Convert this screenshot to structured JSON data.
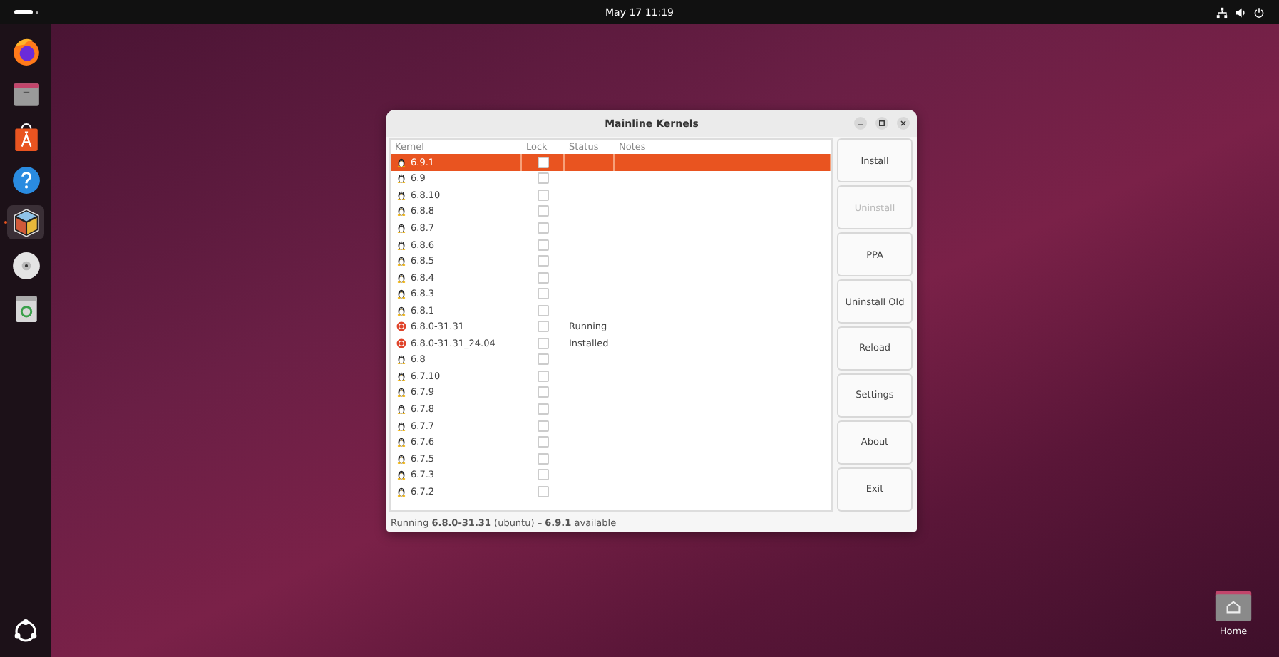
{
  "top_bar": {
    "clock": "May 17  11:19"
  },
  "dock": {
    "items": [
      {
        "kind": "browser",
        "selected": false
      },
      {
        "kind": "files",
        "selected": false
      },
      {
        "kind": "store",
        "selected": false
      },
      {
        "kind": "help",
        "selected": false
      },
      {
        "kind": "cube",
        "selected": true
      },
      {
        "kind": "disc",
        "selected": false
      },
      {
        "kind": "trash",
        "selected": false
      }
    ]
  },
  "window": {
    "title": "Mainline Kernels",
    "table": {
      "columns": [
        "Kernel",
        "Lock",
        "Status",
        "Notes"
      ],
      "rows": [
        {
          "kind": "mainline",
          "kernel": "6.9.1",
          "locked": false,
          "selected": true
        },
        {
          "kind": "mainline",
          "kernel": "6.9",
          "locked": false,
          "selected": false
        },
        {
          "kind": "mainline",
          "kernel": "6.8.10",
          "locked": false,
          "selected": false
        },
        {
          "kind": "mainline",
          "kernel": "6.8.8",
          "locked": false,
          "selected": false
        },
        {
          "kind": "mainline",
          "kernel": "6.8.7",
          "locked": false,
          "selected": false
        },
        {
          "kind": "mainline",
          "kernel": "6.8.6",
          "locked": false,
          "selected": false
        },
        {
          "kind": "mainline",
          "kernel": "6.8.5",
          "locked": false,
          "selected": false
        },
        {
          "kind": "mainline",
          "kernel": "6.8.4",
          "locked": false,
          "selected": false
        },
        {
          "kind": "mainline",
          "kernel": "6.8.3",
          "locked": false,
          "selected": false
        },
        {
          "kind": "mainline",
          "kernel": "6.8.1",
          "locked": false,
          "selected": false
        },
        {
          "kind": "distro",
          "kernel": "6.8.0-31.31",
          "locked": false,
          "status": "Running",
          "selected": false
        },
        {
          "kind": "distro",
          "kernel": "6.8.0-31.31_24.04",
          "locked": false,
          "status": "Installed",
          "selected": false
        },
        {
          "kind": "mainline",
          "kernel": "6.8",
          "locked": false,
          "selected": false
        },
        {
          "kind": "mainline",
          "kernel": "6.7.10",
          "locked": false,
          "selected": false
        },
        {
          "kind": "mainline",
          "kernel": "6.7.9",
          "locked": false,
          "selected": false
        },
        {
          "kind": "mainline",
          "kernel": "6.7.8",
          "locked": false,
          "selected": false
        },
        {
          "kind": "mainline",
          "kernel": "6.7.7",
          "locked": false,
          "selected": false
        },
        {
          "kind": "mainline",
          "kernel": "6.7.6",
          "locked": false,
          "selected": false
        },
        {
          "kind": "mainline",
          "kernel": "6.7.5",
          "locked": false,
          "selected": false
        },
        {
          "kind": "mainline",
          "kernel": "6.7.3",
          "locked": false,
          "selected": false
        },
        {
          "kind": "mainline",
          "kernel": "6.7.2",
          "locked": false,
          "selected": false
        }
      ]
    },
    "buttons": [
      {
        "label": "Install",
        "disabled": false
      },
      {
        "label": "Uninstall",
        "disabled": true
      },
      {
        "label": "PPA",
        "disabled": false
      },
      {
        "label": "Uninstall Old",
        "disabled": false
      },
      {
        "label": "Reload",
        "disabled": false
      },
      {
        "label": "Settings",
        "disabled": false
      },
      {
        "label": "About",
        "disabled": false
      },
      {
        "label": "Exit",
        "disabled": false
      }
    ],
    "status_bar": "Running **6.8.0-31.31** (ubuntu) – **6.9.1** available"
  },
  "desktop_icons": [
    {
      "label": "Home"
    }
  ]
}
